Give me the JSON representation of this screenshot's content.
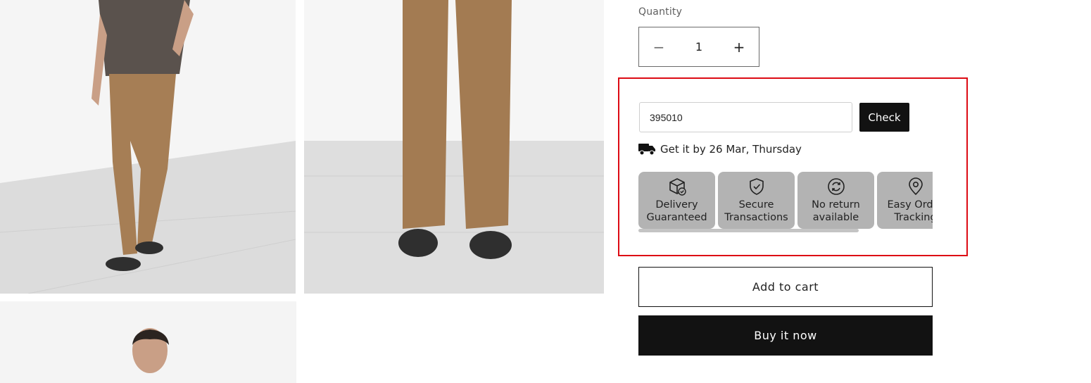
{
  "gallery": {
    "images": [
      {
        "alt": "man-walking-in-khaki-pants"
      },
      {
        "alt": "back-view-khaki-pants"
      },
      {
        "alt": "man-portrait"
      }
    ]
  },
  "quantity": {
    "label": "Quantity",
    "value": "1",
    "decrease_symbol": "−",
    "increase_symbol": "+"
  },
  "pincode": {
    "input_value": "395010",
    "check_label": "Check",
    "delivery_text": "Get it by 26 Mar, Thursday",
    "delivery_icon": "truck-icon"
  },
  "features": [
    {
      "icon": "package-check-icon",
      "line1": "Delivery",
      "line2": "Guaranteed"
    },
    {
      "icon": "shield-check-icon",
      "line1": "Secure",
      "line2": "Transactions"
    },
    {
      "icon": "refresh-icon",
      "line1": "No return",
      "line2": "available"
    },
    {
      "icon": "location-pin-icon",
      "line1": "Easy Order",
      "line2": "Tracking"
    }
  ],
  "actions": {
    "add_to_cart": "Add to cart",
    "buy_now": "Buy it now"
  },
  "colors": {
    "highlight_border": "#dd0b14",
    "primary_button": "#121212",
    "feature_card": "#b3b3b3"
  }
}
